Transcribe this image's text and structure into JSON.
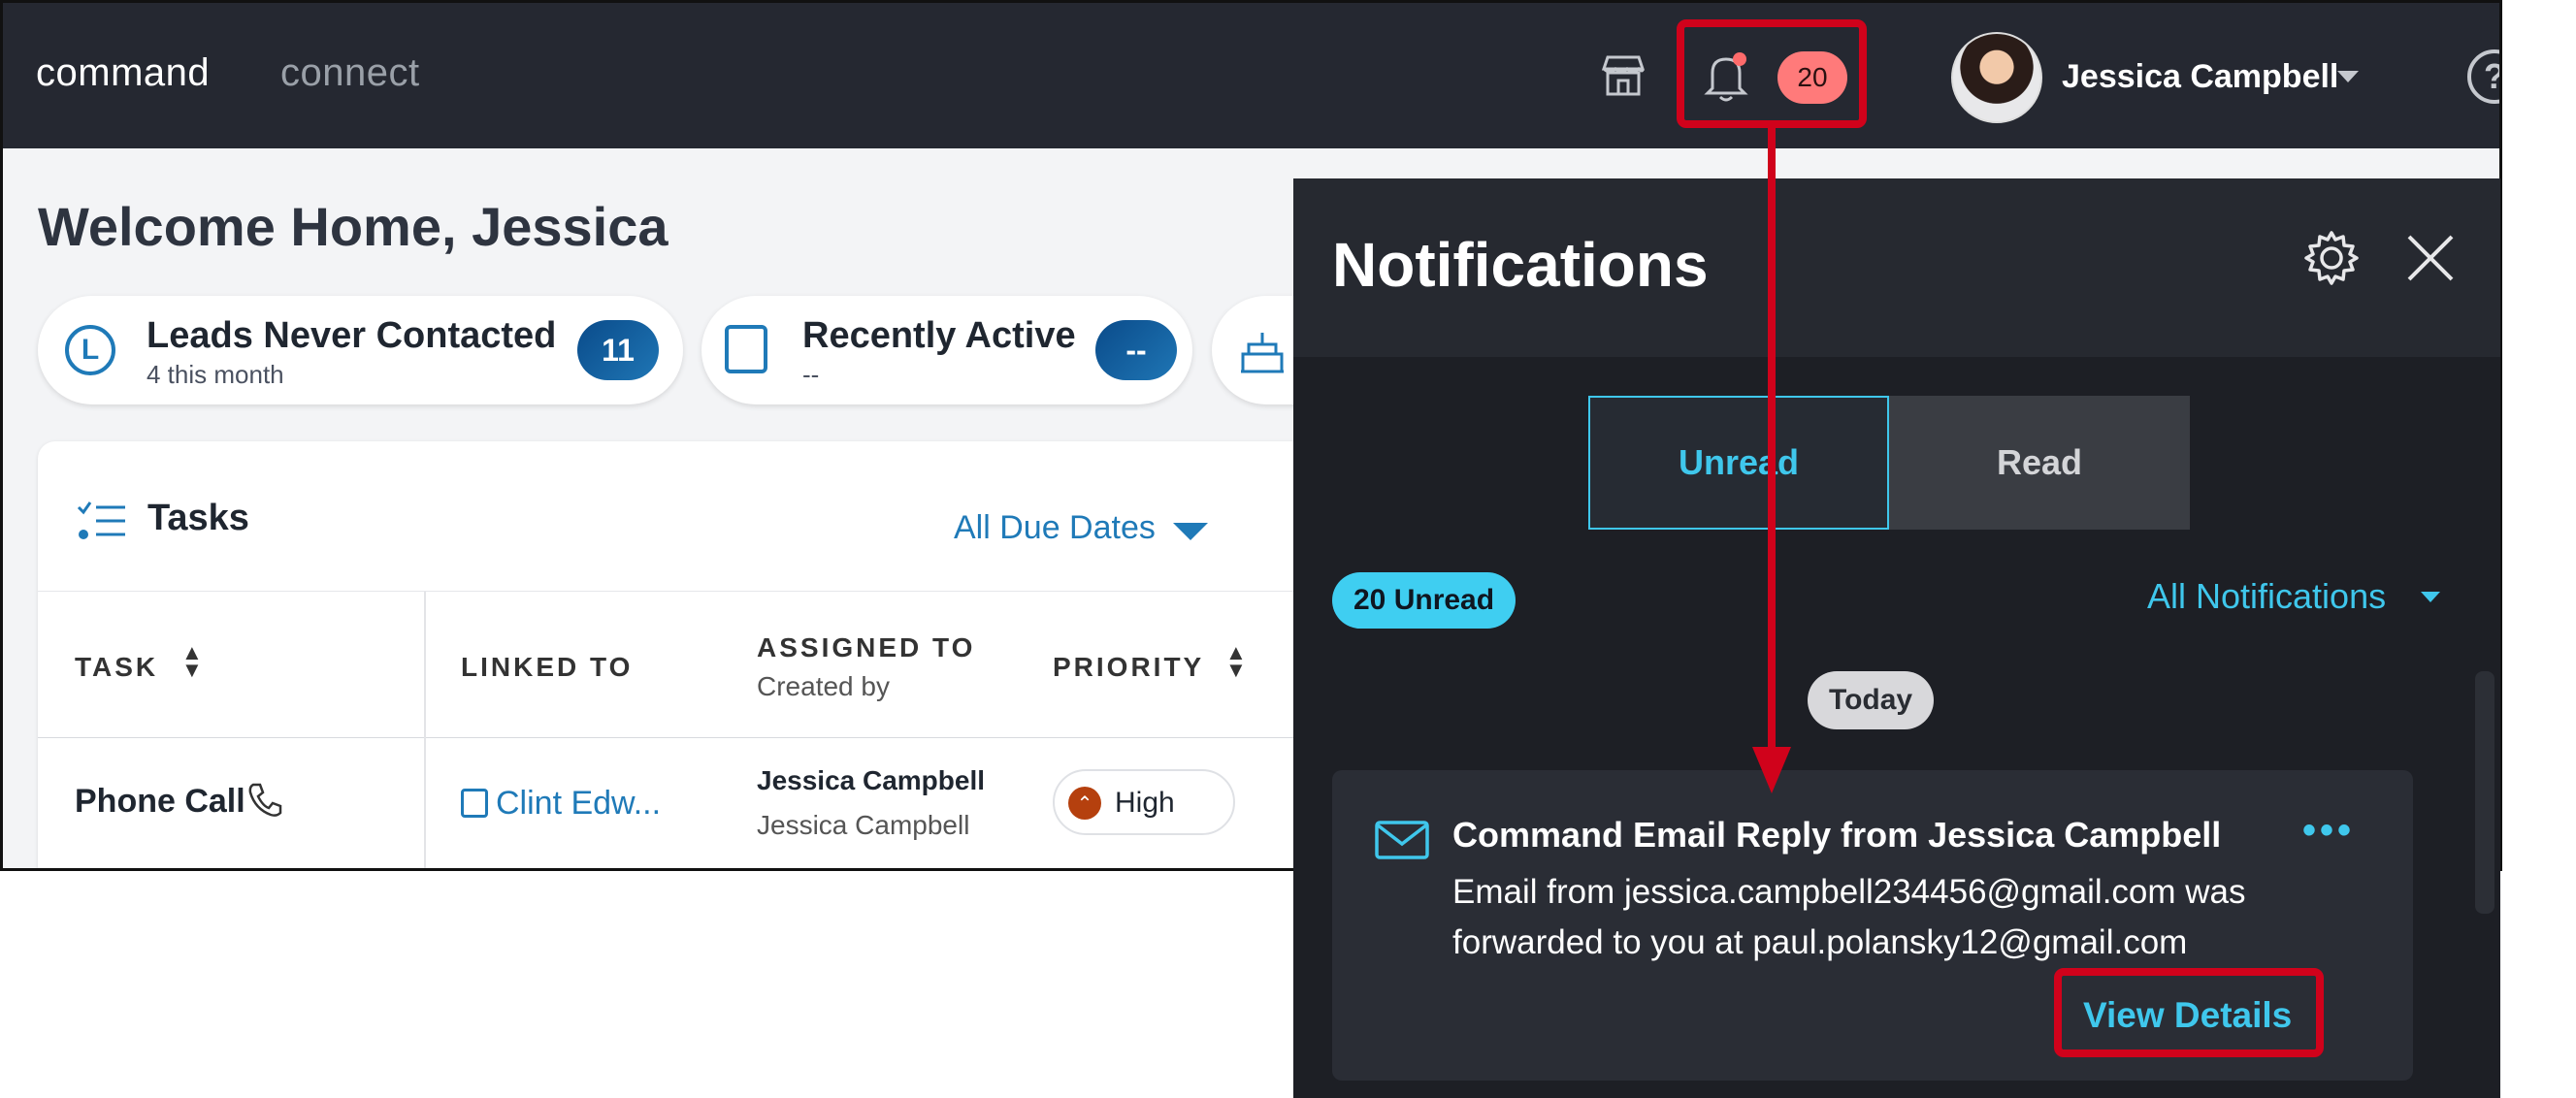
{
  "topbar": {
    "brand_primary": "command",
    "brand_secondary": "connect",
    "icons": [
      "store-icon",
      "bell-icon"
    ],
    "notification_count": "20",
    "user_name": "Jessica Campbell",
    "help_icon": "help-icon"
  },
  "welcome": "Welcome Home, Jessica",
  "stats": [
    {
      "title": "Leads Never Contacted",
      "sub": "4 this month",
      "count": "11",
      "icon": "clock-l-icon"
    },
    {
      "title": "Recently Active",
      "sub": "--",
      "count": "--",
      "icon": "contact-card-icon"
    },
    {
      "icon": "cake-icon"
    }
  ],
  "tasks": {
    "title": "Tasks",
    "filter": "All Due Dates",
    "columns": [
      "TASK",
      "LINKED TO",
      "ASSIGNED TO",
      "PRIORITY"
    ],
    "assigned_sub": "Created by",
    "row": {
      "task": "Phone Call",
      "linked": "Clint Edw...",
      "assigned": "Jessica Campbell",
      "created": "Jessica Campbell",
      "priority": "High"
    }
  },
  "panel": {
    "title": "Notifications",
    "tabs": [
      "Unread",
      "Read"
    ],
    "active_tab": "Unread",
    "unread_badge": "20 Unread",
    "filter": "All Notifications",
    "day_label": "Today",
    "notification": {
      "title": "Command Email Reply from Jessica Campbell",
      "body_line1": "Email from jessica.campbell234456@gmail.com was",
      "body_line2": "forwarded to you at paul.polansky12@gmail.com",
      "action": "View Details"
    }
  },
  "colors": {
    "topbar": "#252831",
    "accent": "#3fc7ec",
    "highlight": "#d0021b",
    "badge": "#ff7a7a",
    "link_blue": "#1f7ab8"
  }
}
